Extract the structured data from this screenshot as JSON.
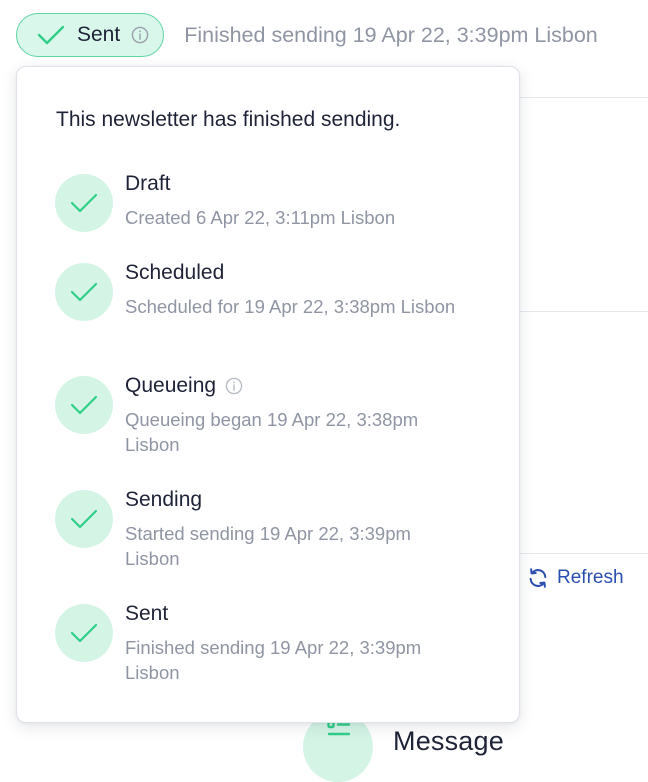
{
  "status": {
    "pill_label": "Sent",
    "summary": "Finished sending 19 Apr 22, 3:39pm Lisbon"
  },
  "popover": {
    "intro": "This newsletter has finished sending.",
    "steps": [
      {
        "title": "Draft",
        "description": "Created 6 Apr 22, 3:11pm Lisbon",
        "icon": "check-icon",
        "info": false
      },
      {
        "title": "Scheduled",
        "description": "Scheduled for 19 Apr 22, 3:38pm Lisbon",
        "icon": "check-icon",
        "info": false
      },
      {
        "title": "Queueing",
        "description": "Queueing began 19 Apr 22, 3:38pm Lisbon",
        "icon": "check-icon",
        "info": true
      },
      {
        "title": "Sending",
        "description": "Started sending 19 Apr 22, 3:39pm Lisbon",
        "icon": "check-icon",
        "info": false
      },
      {
        "title": "Sent",
        "description": "Finished sending 19 Apr 22, 3:39pm Lisbon",
        "icon": "check-icon",
        "info": false
      }
    ]
  },
  "background": {
    "refresh_label": "Refresh",
    "message_label": "Message"
  },
  "colors": {
    "accent_green": "#30cf88",
    "pill_background": "#d9f7ea",
    "pill_border": "#5fd5a3",
    "step_circle": "#d4f5e6",
    "text_primary": "#1e2337",
    "text_muted": "#8f95a3",
    "link_blue": "#2a4fb0"
  }
}
